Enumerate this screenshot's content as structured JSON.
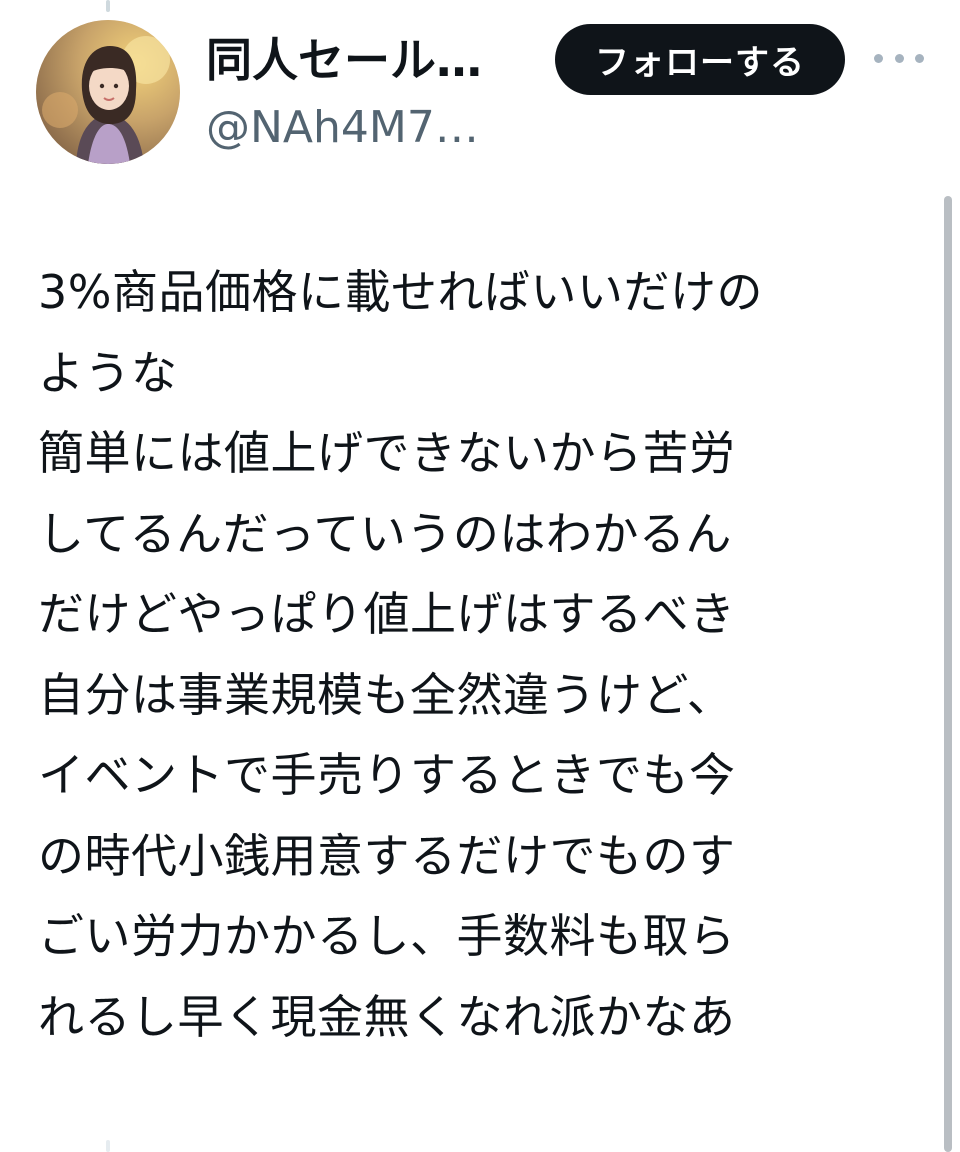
{
  "author": {
    "display_name": "同人セール…",
    "handle": "@NAh4M7…"
  },
  "follow_button": {
    "label": "フォローする"
  },
  "more_menu": {
    "icon": "more-horizontal-icon"
  },
  "tweet": {
    "lines": [
      "3%商品価格に載せればいいだけの",
      "ような",
      "簡単には値上げできないから苦労",
      "してるんだっていうのはわかるん",
      "だけどやっぱり値上げはするべき",
      "自分は事業規模も全然違うけど、",
      "イベントで手売りするときでも今",
      "の時代小銭用意するだけでものす",
      "ごい労力かかるし、手数料も取ら",
      "れるし早く現金無くなれ派かなあ"
    ]
  },
  "colors": {
    "text": "#0f1419",
    "secondary_text": "#536471",
    "button_bg": "#0f1419",
    "button_text": "#ffffff",
    "more_dots": "#a6b3bf"
  }
}
